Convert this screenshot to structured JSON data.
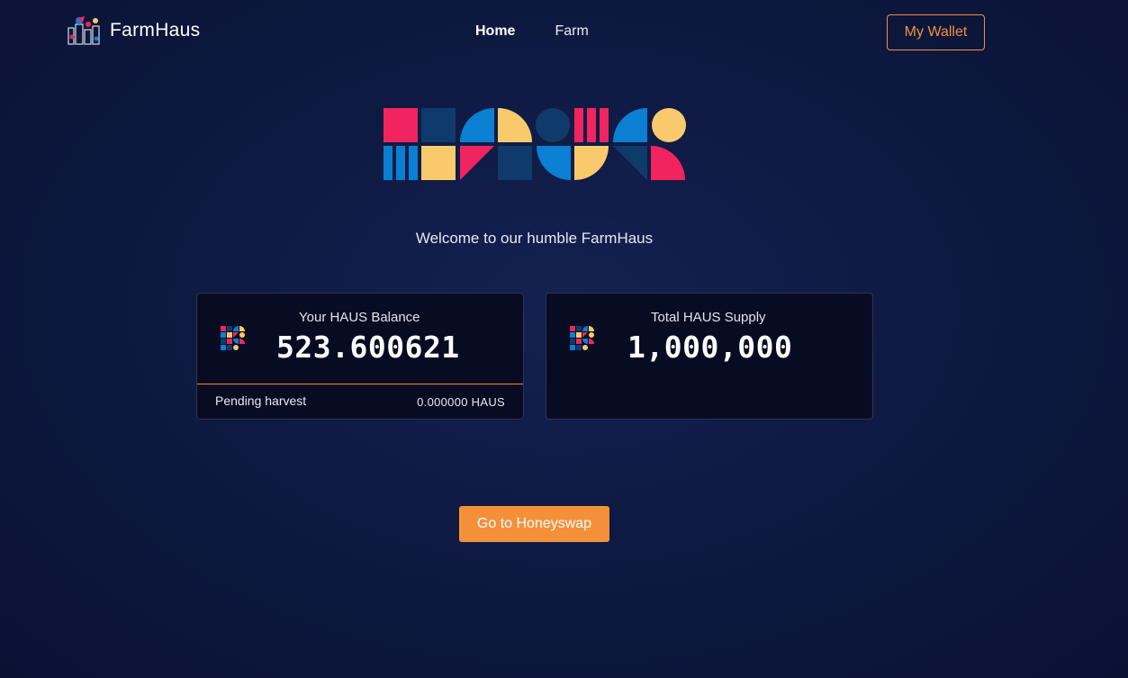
{
  "header": {
    "brand_name": "FarmHaus",
    "nav": [
      {
        "label": "Home",
        "active": true
      },
      {
        "label": "Farm",
        "active": false
      }
    ],
    "wallet_label": "My Wallet"
  },
  "hero": {
    "logo_icon": "haus-wordmark-logo",
    "welcome_text": "Welcome to our humble FarmHaus"
  },
  "cards": {
    "balance": {
      "icon": "haus-token-icon",
      "title": "Your HAUS Balance",
      "value": "523.600621",
      "pending_label": "Pending harvest",
      "pending_value": "0.000000 HAUS"
    },
    "supply": {
      "icon": "haus-token-icon",
      "title": "Total HAUS Supply",
      "value": "1,000,000"
    }
  },
  "actions": {
    "honeyswap_label": "Go to Honeyswap"
  },
  "colors": {
    "accent": "#f5903a",
    "background": "#0e1a42",
    "card_background": "#080c22",
    "pink": "#f0245f",
    "blue": "#0b7fd1",
    "navy": "#0f3b6b",
    "yellow": "#f8ca6c"
  }
}
